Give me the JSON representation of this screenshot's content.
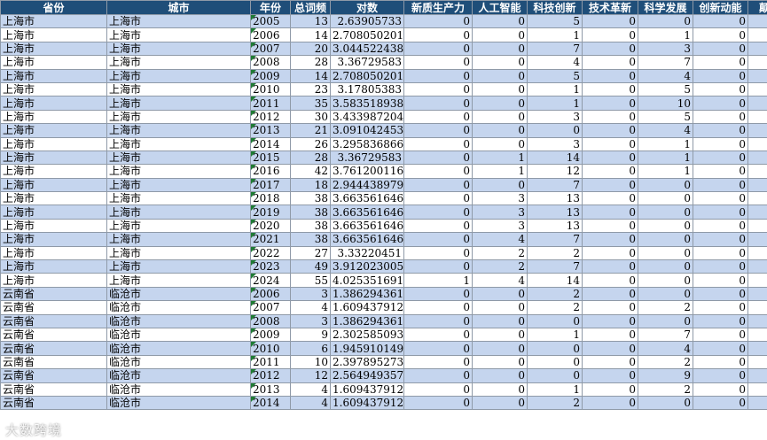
{
  "headers": [
    "省份",
    "城市",
    "年份",
    "总词频",
    "对数",
    "新质生产力",
    "人工智能",
    "科技创新",
    "技术革新",
    "科学发展",
    "创新动能",
    "颠"
  ],
  "rows": [
    [
      "上海市",
      "上海市",
      "2005",
      "13",
      "2.63905733",
      "0",
      "0",
      "5",
      "0",
      "0",
      "0"
    ],
    [
      "上海市",
      "上海市",
      "2006",
      "14",
      "2.708050201",
      "0",
      "0",
      "1",
      "0",
      "1",
      "0"
    ],
    [
      "上海市",
      "上海市",
      "2007",
      "20",
      "3.044522438",
      "0",
      "0",
      "7",
      "0",
      "3",
      "0"
    ],
    [
      "上海市",
      "上海市",
      "2008",
      "28",
      "3.36729583",
      "0",
      "0",
      "4",
      "0",
      "7",
      "0"
    ],
    [
      "上海市",
      "上海市",
      "2009",
      "14",
      "2.708050201",
      "0",
      "0",
      "5",
      "0",
      "4",
      "0"
    ],
    [
      "上海市",
      "上海市",
      "2010",
      "23",
      "3.17805383",
      "0",
      "0",
      "1",
      "0",
      "5",
      "0"
    ],
    [
      "上海市",
      "上海市",
      "2011",
      "35",
      "3.583518938",
      "0",
      "0",
      "1",
      "0",
      "10",
      "0"
    ],
    [
      "上海市",
      "上海市",
      "2012",
      "30",
      "3.433987204",
      "0",
      "0",
      "3",
      "0",
      "5",
      "0"
    ],
    [
      "上海市",
      "上海市",
      "2013",
      "21",
      "3.091042453",
      "0",
      "0",
      "0",
      "0",
      "4",
      "0"
    ],
    [
      "上海市",
      "上海市",
      "2014",
      "26",
      "3.295836866",
      "0",
      "0",
      "3",
      "0",
      "1",
      "0"
    ],
    [
      "上海市",
      "上海市",
      "2015",
      "28",
      "3.36729583",
      "0",
      "1",
      "14",
      "0",
      "1",
      "0"
    ],
    [
      "上海市",
      "上海市",
      "2016",
      "42",
      "3.761200116",
      "0",
      "1",
      "12",
      "0",
      "1",
      "0"
    ],
    [
      "上海市",
      "上海市",
      "2017",
      "18",
      "2.944438979",
      "0",
      "0",
      "7",
      "0",
      "0",
      "0"
    ],
    [
      "上海市",
      "上海市",
      "2018",
      "38",
      "3.663561646",
      "0",
      "3",
      "13",
      "0",
      "0",
      "0"
    ],
    [
      "上海市",
      "上海市",
      "2019",
      "38",
      "3.663561646",
      "0",
      "3",
      "13",
      "0",
      "0",
      "0"
    ],
    [
      "上海市",
      "上海市",
      "2020",
      "38",
      "3.663561646",
      "0",
      "3",
      "13",
      "0",
      "0",
      "0"
    ],
    [
      "上海市",
      "上海市",
      "2021",
      "38",
      "3.663561646",
      "0",
      "4",
      "7",
      "0",
      "0",
      "0"
    ],
    [
      "上海市",
      "上海市",
      "2022",
      "27",
      "3.33220451",
      "0",
      "2",
      "2",
      "0",
      "0",
      "0"
    ],
    [
      "上海市",
      "上海市",
      "2023",
      "49",
      "3.912023005",
      "0",
      "2",
      "7",
      "0",
      "0",
      "0"
    ],
    [
      "上海市",
      "上海市",
      "2024",
      "55",
      "4.025351691",
      "1",
      "4",
      "14",
      "0",
      "0",
      "0"
    ],
    [
      "云南省",
      "临沧市",
      "2006",
      "3",
      "1.386294361",
      "0",
      "0",
      "2",
      "0",
      "0",
      "0"
    ],
    [
      "云南省",
      "临沧市",
      "2007",
      "4",
      "1.609437912",
      "0",
      "0",
      "2",
      "0",
      "2",
      "0"
    ],
    [
      "云南省",
      "临沧市",
      "2008",
      "3",
      "1.386294361",
      "0",
      "0",
      "0",
      "0",
      "0",
      "0"
    ],
    [
      "云南省",
      "临沧市",
      "2009",
      "9",
      "2.302585093",
      "0",
      "0",
      "1",
      "0",
      "7",
      "0"
    ],
    [
      "云南省",
      "临沧市",
      "2010",
      "6",
      "1.945910149",
      "0",
      "0",
      "0",
      "0",
      "4",
      "0"
    ],
    [
      "云南省",
      "临沧市",
      "2011",
      "10",
      "2.397895273",
      "0",
      "0",
      "0",
      "0",
      "2",
      "0"
    ],
    [
      "云南省",
      "临沧市",
      "2012",
      "12",
      "2.564949357",
      "0",
      "0",
      "0",
      "0",
      "9",
      "0"
    ],
    [
      "云南省",
      "临沧市",
      "2013",
      "4",
      "1.609437912",
      "0",
      "0",
      "1",
      "0",
      "2",
      "0"
    ],
    [
      "云南省",
      "临沧市",
      "2014",
      "4",
      "1.609437912",
      "0",
      "0",
      "2",
      "0",
      "0",
      "0"
    ]
  ],
  "watermark": "大数跨境"
}
